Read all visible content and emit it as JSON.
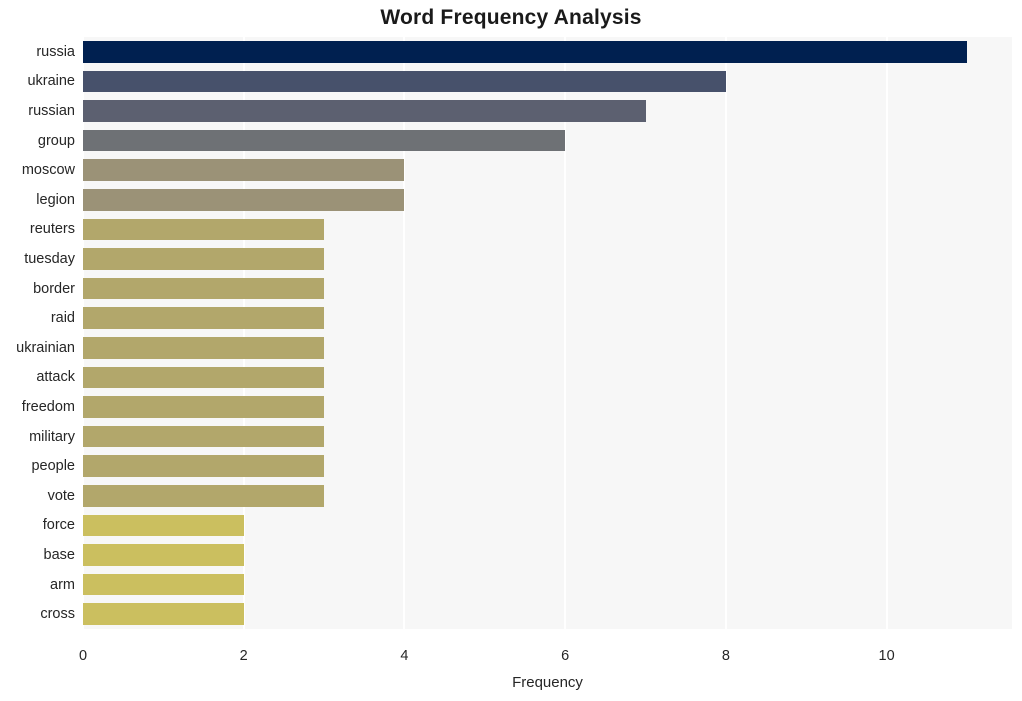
{
  "chart_data": {
    "type": "bar",
    "orientation": "horizontal",
    "title": "Word Frequency Analysis",
    "xlabel": "Frequency",
    "ylabel": "",
    "xlim": [
      0,
      11.56
    ],
    "xticks": [
      0,
      2,
      4,
      6,
      8,
      10
    ],
    "xtick_labels": [
      "0",
      "2",
      "4",
      "6",
      "8",
      "10"
    ],
    "grid": "vertical-white-gridlines",
    "legend": "none",
    "plot_background": "#f7f7f7",
    "figure_background": "#ffffff",
    "categories": [
      "russia",
      "ukraine",
      "russian",
      "group",
      "moscow",
      "legion",
      "reuters",
      "tuesday",
      "border",
      "raid",
      "ukrainian",
      "attack",
      "freedom",
      "military",
      "people",
      "vote",
      "force",
      "base",
      "arm",
      "cross"
    ],
    "values": [
      11,
      8,
      7,
      6,
      4,
      4,
      3,
      3,
      3,
      3,
      3,
      3,
      3,
      3,
      3,
      3,
      2,
      2,
      2,
      2
    ],
    "bar_colors": [
      "#002050",
      "#47516b",
      "#5c6070",
      "#6e7175",
      "#9b9277",
      "#9b9277",
      "#b2a76b",
      "#b2a76b",
      "#b2a76b",
      "#b2a76b",
      "#b2a76b",
      "#b2a76b",
      "#b2a76b",
      "#b2a76b",
      "#b2a76b",
      "#b2a76b",
      "#cbbf5f",
      "#cbbf5f",
      "#cbbf5f",
      "#cbbf5f"
    ],
    "bars": [
      {
        "label": "russia",
        "value": 11,
        "color": "#002050"
      },
      {
        "label": "ukraine",
        "value": 8,
        "color": "#47516b"
      },
      {
        "label": "russian",
        "value": 7,
        "color": "#5c6070"
      },
      {
        "label": "group",
        "value": 6,
        "color": "#6e7175"
      },
      {
        "label": "moscow",
        "value": 4,
        "color": "#9b9277"
      },
      {
        "label": "legion",
        "value": 4,
        "color": "#9b9277"
      },
      {
        "label": "reuters",
        "value": 3,
        "color": "#b2a76b"
      },
      {
        "label": "tuesday",
        "value": 3,
        "color": "#b2a76b"
      },
      {
        "label": "border",
        "value": 3,
        "color": "#b2a76b"
      },
      {
        "label": "raid",
        "value": 3,
        "color": "#b2a76b"
      },
      {
        "label": "ukrainian",
        "value": 3,
        "color": "#b2a76b"
      },
      {
        "label": "attack",
        "value": 3,
        "color": "#b2a76b"
      },
      {
        "label": "freedom",
        "value": 3,
        "color": "#b2a76b"
      },
      {
        "label": "military",
        "value": 3,
        "color": "#b2a76b"
      },
      {
        "label": "people",
        "value": 3,
        "color": "#b2a76b"
      },
      {
        "label": "vote",
        "value": 3,
        "color": "#b2a76b"
      },
      {
        "label": "force",
        "value": 2,
        "color": "#cbbf5f"
      },
      {
        "label": "base",
        "value": 2,
        "color": "#cbbf5f"
      },
      {
        "label": "arm",
        "value": 2,
        "color": "#cbbf5f"
      },
      {
        "label": "cross",
        "value": 2,
        "color": "#cbbf5f"
      }
    ]
  }
}
